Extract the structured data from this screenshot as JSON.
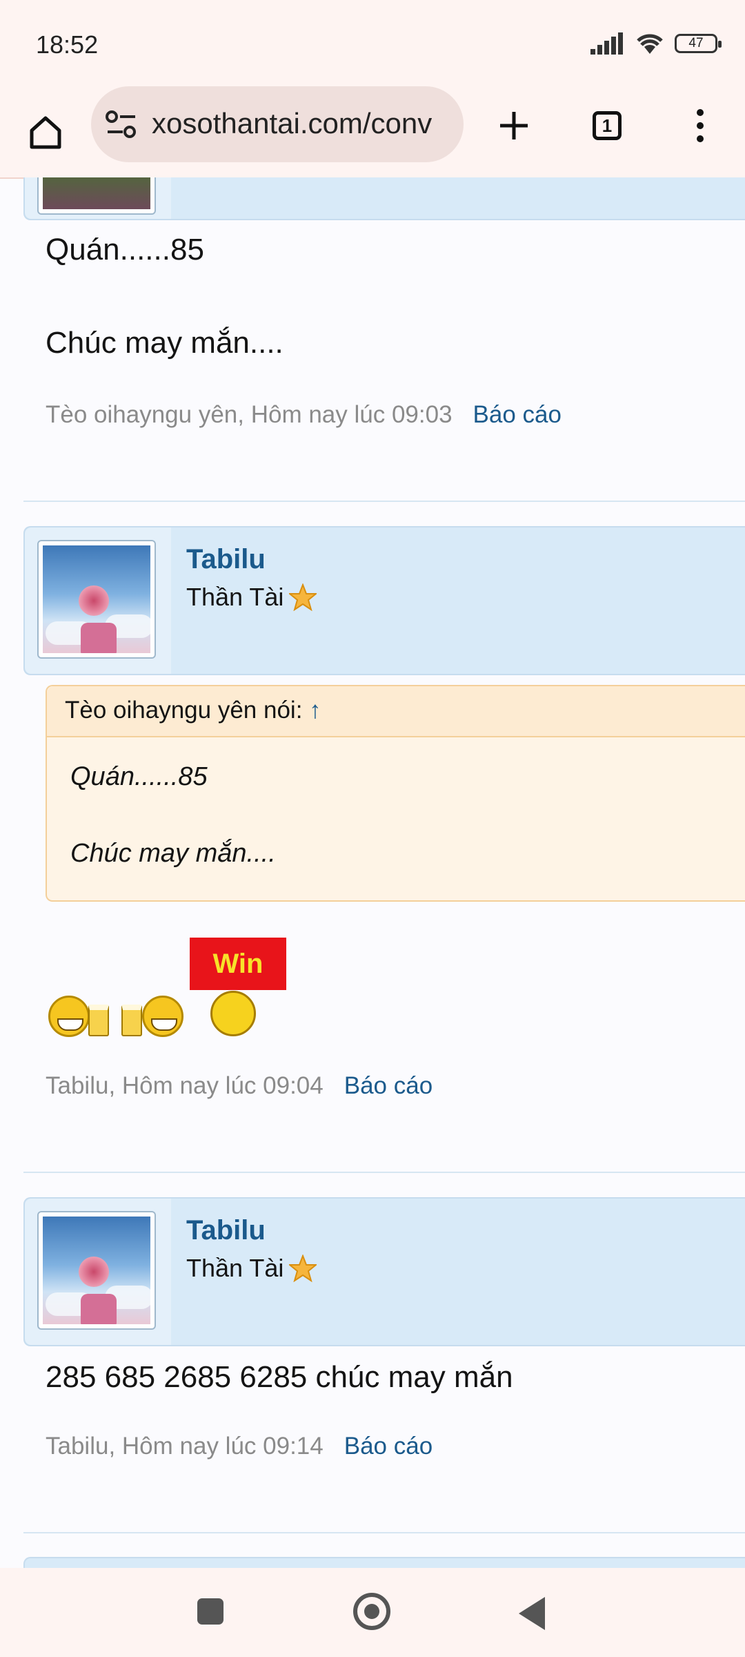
{
  "status_bar": {
    "time": "18:52",
    "battery": "47"
  },
  "browser": {
    "url": "xosothantai.com/conv",
    "tab_count": "1"
  },
  "posts": [
    {
      "message_lines": [
        "Quán......85",
        "Chúc may mắn...."
      ],
      "meta": "Tèo oihayngu yên, Hôm nay lúc 09:03",
      "report": "Báo cáo"
    },
    {
      "username": "Tabilu",
      "user_title": "Thần Tài",
      "quote": {
        "header": "Tèo oihayngu yên nói:",
        "arrow": "↑",
        "lines": [
          "Quán......85",
          "Chúc may mắn...."
        ]
      },
      "win_sign": "Win",
      "meta": "Tabilu, Hôm nay lúc 09:04",
      "report": "Báo cáo"
    },
    {
      "username": "Tabilu",
      "user_title": "Thần Tài",
      "message": "285 685 2685 6285 chúc may mắn",
      "meta": "Tabilu, Hôm nay lúc 09:14",
      "report": "Báo cáo"
    }
  ],
  "colors": {
    "link": "#1b5a8c",
    "header_bg": "#d8eaf8",
    "quote_bg": "#fef4e6"
  }
}
